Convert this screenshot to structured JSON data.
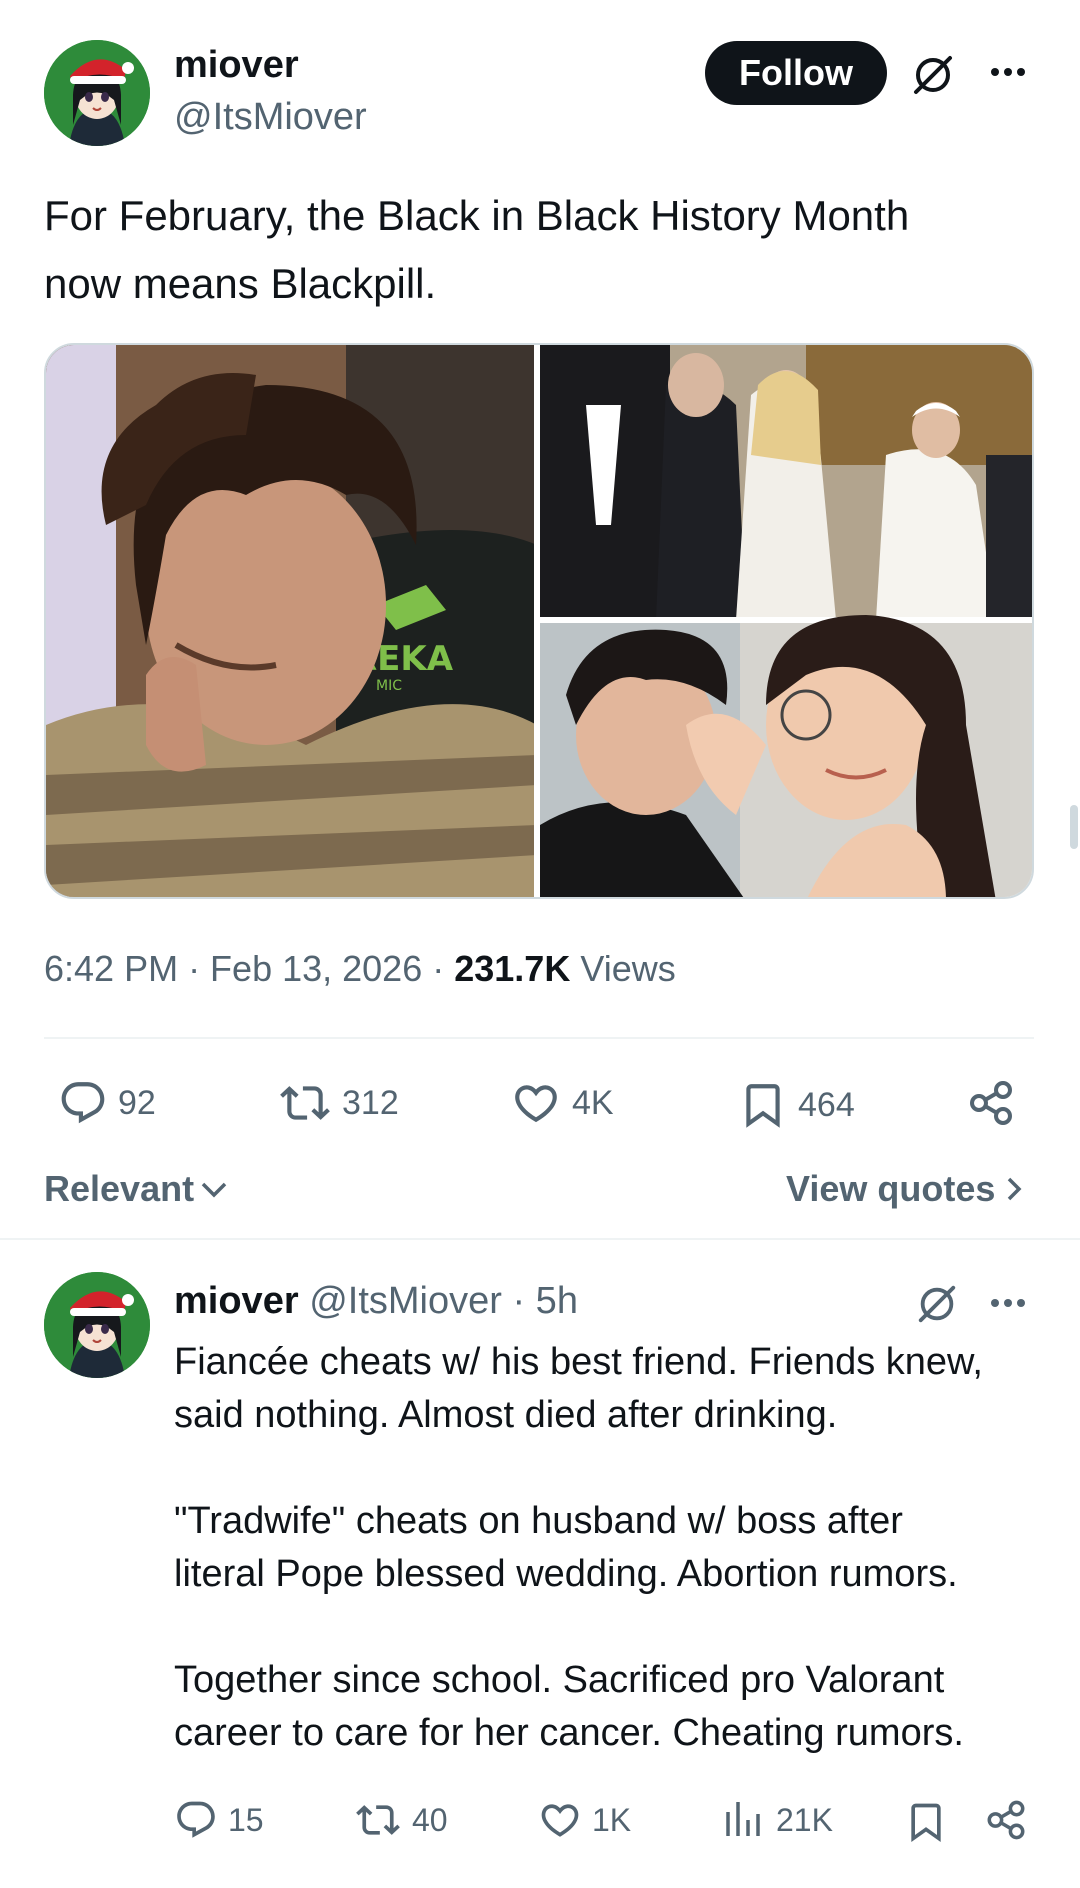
{
  "post": {
    "author_name": "miover",
    "author_handle": "@ItsMiover",
    "follow_label": "Follow",
    "text_line1": "For February, the Black in Black History Month",
    "text_line2": "now means Blackpill.",
    "chair_text": "REKA",
    "chair_subtext": "MIC",
    "timestamp": "6:42 PM · Feb 13, 2026 · ",
    "views_count": "231.7K",
    "views_label": " Views",
    "stats": {
      "replies": "92",
      "reposts": "312",
      "likes": "4K",
      "bookmarks": "464"
    }
  },
  "sort": {
    "label": "Relevant",
    "quotes_label": "View quotes"
  },
  "reply": {
    "author_name": "miover",
    "author_handle": "@ItsMiover",
    "time": "· 5h",
    "p1_l1": "Fiancée cheats w/ his best friend. Friends knew,",
    "p1_l2": "said nothing. Almost died after drinking.",
    "p2_l1": "\"Tradwife\" cheats on husband w/ boss after",
    "p2_l2": "literal Pope blessed wedding. Abortion rumors.",
    "p3_l1": "Together since school. Sacrificed pro Valorant",
    "p3_l2": "career to care for her cancer. Cheating rumors.",
    "stats": {
      "replies": "15",
      "reposts": "40",
      "likes": "1K",
      "views": "21K"
    }
  }
}
